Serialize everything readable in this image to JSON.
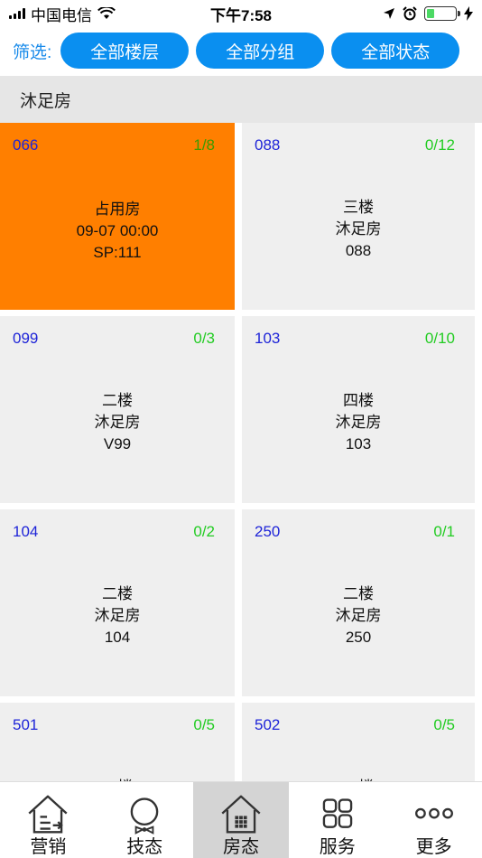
{
  "status_bar": {
    "carrier": "中国电信",
    "time": "下午7:58"
  },
  "filter": {
    "label": "筛选:",
    "buttons": [
      "全部楼层",
      "全部分组",
      "全部状态"
    ]
  },
  "section": {
    "title": "沐足房"
  },
  "colors": {
    "accent": "#0a8ff0",
    "occupied": "#ff7f00",
    "code_text": "#1e24d8",
    "count_text": "#22cc22"
  },
  "rooms": [
    {
      "code": "066",
      "count": "1/8",
      "state": "occupied",
      "lines": [
        "占用房",
        "09-07 00:00",
        "SP:111"
      ]
    },
    {
      "code": "088",
      "count": "0/12",
      "state": "free",
      "lines": [
        "三楼",
        "沐足房",
        "088"
      ]
    },
    {
      "code": "099",
      "count": "0/3",
      "state": "free",
      "lines": [
        "二楼",
        "沐足房",
        "V99"
      ]
    },
    {
      "code": "103",
      "count": "0/10",
      "state": "free",
      "lines": [
        "四楼",
        "沐足房",
        "103"
      ]
    },
    {
      "code": "104",
      "count": "0/2",
      "state": "free",
      "lines": [
        "二楼",
        "沐足房",
        "104"
      ]
    },
    {
      "code": "250",
      "count": "0/1",
      "state": "free",
      "lines": [
        "二楼",
        "沐足房",
        "250"
      ]
    },
    {
      "code": "501",
      "count": "0/5",
      "state": "free",
      "lines": [
        "二楼",
        "",
        ""
      ]
    },
    {
      "code": "502",
      "count": "0/5",
      "state": "free",
      "lines": [
        "二楼",
        "",
        ""
      ]
    }
  ],
  "tabs": [
    {
      "label": "营销",
      "icon": "house-list-icon",
      "active": false
    },
    {
      "label": "技态",
      "icon": "person-bowtie-icon",
      "active": false
    },
    {
      "label": "房态",
      "icon": "house-grid-icon",
      "active": true
    },
    {
      "label": "服务",
      "icon": "service-grid-icon",
      "active": false
    },
    {
      "label": "更多",
      "icon": "more-dots-icon",
      "active": false
    }
  ]
}
